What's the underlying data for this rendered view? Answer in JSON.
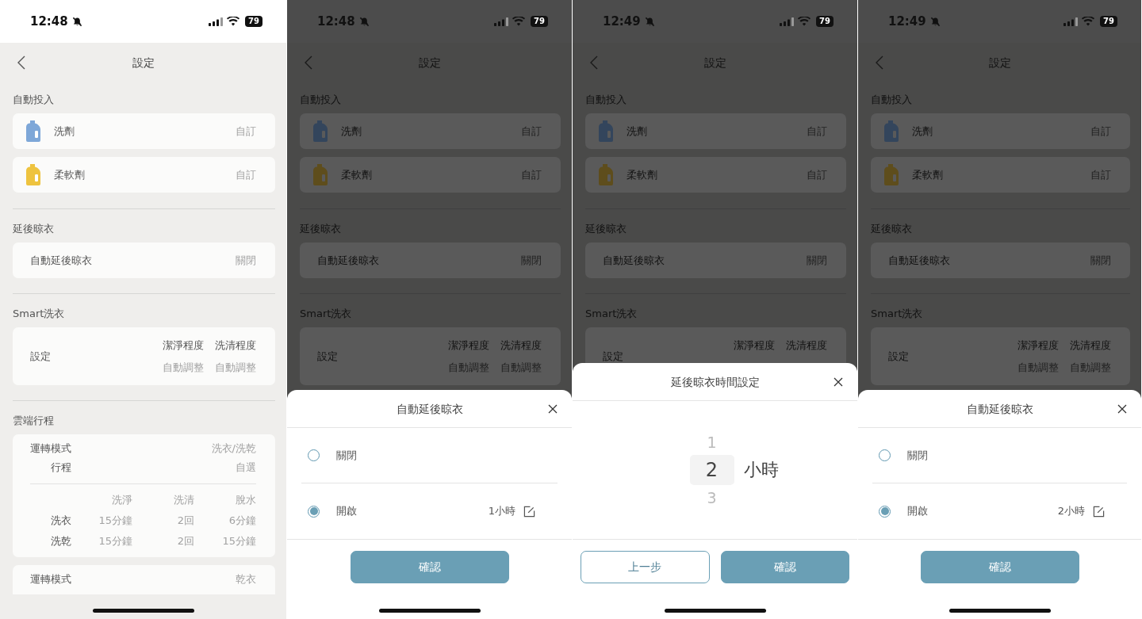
{
  "phones": [
    {
      "time": "12:48",
      "silent": true,
      "battery": "79",
      "dimmed": false,
      "title": "設定",
      "sections": [
        {
          "label": "自動投入",
          "cards": [
            {
              "kind": "supply",
              "color": "#7ea7d8",
              "name": "洗劑",
              "value": "自訂"
            },
            {
              "kind": "supply",
              "color": "#eec33f",
              "name": "柔軟劑",
              "value": "自訂"
            }
          ]
        },
        {
          "label": "延後晾衣",
          "cards": [
            {
              "kind": "row",
              "label": "自動延後晾衣",
              "value": "關閉"
            }
          ]
        },
        {
          "label": "Smart洗衣",
          "cards": [
            {
              "kind": "smart",
              "label": "設定",
              "columns": [
                {
                  "heading": "潔淨程度",
                  "value": "自動調整"
                },
                {
                  "heading": "洗清程度",
                  "value": "自動調整"
                }
              ]
            }
          ]
        },
        {
          "label": "雲端行程",
          "cards": [
            {
              "kind": "program",
              "rows": [
                {
                  "label": "運轉模式",
                  "value": "洗衣/洗乾",
                  "children": [
                    {
                      "label": "行程",
                      "value": "自選"
                    }
                  ]
                }
              ],
              "table": {
                "columns": [
                  "洗淨",
                  "洗清",
                  "脫水"
                ],
                "rows": [
                  {
                    "label": "洗衣",
                    "cells": [
                      "15分鐘",
                      "2回",
                      "6分鐘"
                    ]
                  },
                  {
                    "label": "洗乾",
                    "cells": [
                      "15分鐘",
                      "2回",
                      "15分鐘"
                    ]
                  }
                ]
              }
            },
            {
              "kind": "program",
              "rows": [
                {
                  "label": "運轉模式",
                  "value": "乾衣"
                }
              ]
            }
          ]
        }
      ]
    },
    {
      "time": "12:48",
      "silent": true,
      "battery": "79",
      "dimmed": true,
      "title": "設定",
      "sections": [
        {
          "label": "自動投入",
          "cards": [
            {
              "kind": "supply",
              "color": "#33455c",
              "name": "洗劑",
              "value": "自訂"
            },
            {
              "kind": "supply",
              "color": "#5e4d1c",
              "name": "柔軟劑",
              "value": "自訂"
            }
          ]
        },
        {
          "label": "延後晾衣",
          "cards": [
            {
              "kind": "row",
              "label": "自動延後晾衣",
              "value": "關閉"
            }
          ]
        },
        {
          "label": "Smart洗衣",
          "cards": [
            {
              "kind": "smart",
              "label": "設定",
              "columns": [
                {
                  "heading": "潔淨程度",
                  "value": "自動調整"
                },
                {
                  "heading": "洗清程度",
                  "value": "自動調整"
                }
              ]
            }
          ]
        }
      ],
      "sheet": {
        "kind": "options",
        "title": "自動延後晾衣",
        "options": [
          {
            "label": "關閉",
            "selected": false
          },
          {
            "label": "開啟",
            "selected": true,
            "value": "1小時"
          }
        ],
        "confirm": "確認"
      }
    },
    {
      "time": "12:49",
      "silent": true,
      "battery": "79",
      "dimmed": true,
      "title": "設定",
      "sections": [
        {
          "label": "自動投入",
          "cards": [
            {
              "kind": "supply",
              "color": "#33455c",
              "name": "洗劑",
              "value": "自訂"
            },
            {
              "kind": "supply",
              "color": "#5e4d1c",
              "name": "柔軟劑",
              "value": "自訂"
            }
          ]
        },
        {
          "label": "延後晾衣",
          "cards": [
            {
              "kind": "row",
              "label": "自動延後晾衣",
              "value": "關閉"
            }
          ]
        },
        {
          "label": "Smart洗衣",
          "cards": [
            {
              "kind": "smart",
              "label": "設定",
              "columns": [
                {
                  "heading": "潔淨程度"
                },
                {
                  "heading": "洗清程度"
                }
              ]
            }
          ]
        }
      ],
      "sheet": {
        "kind": "picker",
        "title": "延後晾衣時間設定",
        "items": [
          {
            "label": "1",
            "selected": false
          },
          {
            "label": "2",
            "selected": true
          },
          {
            "label": "3",
            "selected": false
          }
        ],
        "unit": "小時",
        "back": "上一步",
        "confirm": "確認"
      }
    },
    {
      "time": "12:49",
      "silent": true,
      "battery": "79",
      "dimmed": true,
      "title": "設定",
      "sections": [
        {
          "label": "自動投入",
          "cards": [
            {
              "kind": "supply",
              "color": "#33455c",
              "name": "洗劑",
              "value": "自訂"
            },
            {
              "kind": "supply",
              "color": "#5e4d1c",
              "name": "柔軟劑",
              "value": "自訂"
            }
          ]
        },
        {
          "label": "延後晾衣",
          "cards": [
            {
              "kind": "row",
              "label": "自動延後晾衣",
              "value": "關閉"
            }
          ]
        },
        {
          "label": "Smart洗衣",
          "cards": [
            {
              "kind": "smart",
              "label": "設定",
              "columns": [
                {
                  "heading": "潔淨程度",
                  "value": "自動調整"
                },
                {
                  "heading": "洗清程度",
                  "value": "自動調整"
                }
              ]
            }
          ]
        }
      ],
      "sheet": {
        "kind": "options",
        "title": "自動延後晾衣",
        "options": [
          {
            "label": "關閉",
            "selected": false
          },
          {
            "label": "開啟",
            "selected": true,
            "value": "2小時"
          }
        ],
        "confirm": "確認"
      }
    }
  ]
}
